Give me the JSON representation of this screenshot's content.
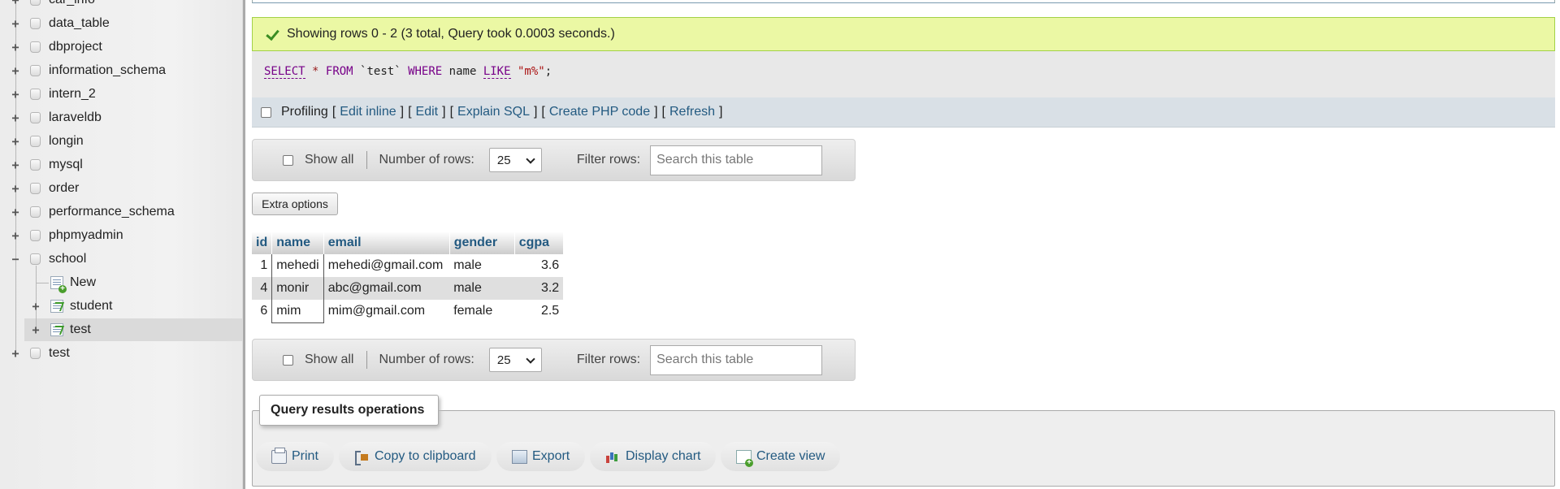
{
  "sidebar": {
    "databases": [
      {
        "label": "car_info"
      },
      {
        "label": "data_table"
      },
      {
        "label": "dbproject"
      },
      {
        "label": "information_schema"
      },
      {
        "label": "intern_2"
      },
      {
        "label": "laraveldb"
      },
      {
        "label": "longin"
      },
      {
        "label": "mysql"
      },
      {
        "label": "order"
      },
      {
        "label": "performance_schema"
      },
      {
        "label": "phpmyadmin"
      },
      {
        "label": "school"
      },
      {
        "label": "test"
      }
    ],
    "school_children": [
      {
        "label": "New"
      },
      {
        "label": "student"
      },
      {
        "label": "test"
      }
    ],
    "expand_symbol": "+",
    "collapse_symbol": "−"
  },
  "success": {
    "message": "Showing rows 0 - 2 (3 total, Query took 0.0003 seconds.)"
  },
  "sql": {
    "kw_select": "SELECT",
    "star": "*",
    "kw_from": "FROM",
    "table": "`test`",
    "kw_where": "WHERE",
    "column": "name",
    "kw_like": "LIKE",
    "pattern": "\"m%\"",
    "semicolon": ";"
  },
  "profiling": {
    "label": "Profiling",
    "open_bracket": "[",
    "close_bracket": "]",
    "edit_inline": "Edit inline",
    "edit": "Edit",
    "explain_sql": "Explain SQL",
    "create_php": "Create PHP code",
    "refresh": "Refresh"
  },
  "nav": {
    "show_all": "Show all",
    "number_of_rows_label": "Number of rows:",
    "number_of_rows_value": "25",
    "filter_label": "Filter rows:",
    "filter_placeholder": "Search this table"
  },
  "extra_options": "Extra options",
  "table": {
    "columns": [
      "id",
      "name",
      "email",
      "gender",
      "cgpa"
    ],
    "rows": [
      {
        "id": "1",
        "name": "mehedi",
        "email": "mehedi@gmail.com",
        "gender": "male",
        "cgpa": "3.6"
      },
      {
        "id": "4",
        "name": "monir",
        "email": "abc@gmail.com",
        "gender": "male",
        "cgpa": "3.2"
      },
      {
        "id": "6",
        "name": "mim",
        "email": "mim@gmail.com",
        "gender": "female",
        "cgpa": "2.5"
      }
    ]
  },
  "operations": {
    "title": "Query results operations",
    "print": "Print",
    "copy": "Copy to clipboard",
    "export": "Export",
    "display_chart": "Display chart",
    "create_view": "Create view"
  },
  "colors": {
    "link": "#235a81",
    "success_bg": "#ebf8a4",
    "sql_keyword": "#770088"
  }
}
